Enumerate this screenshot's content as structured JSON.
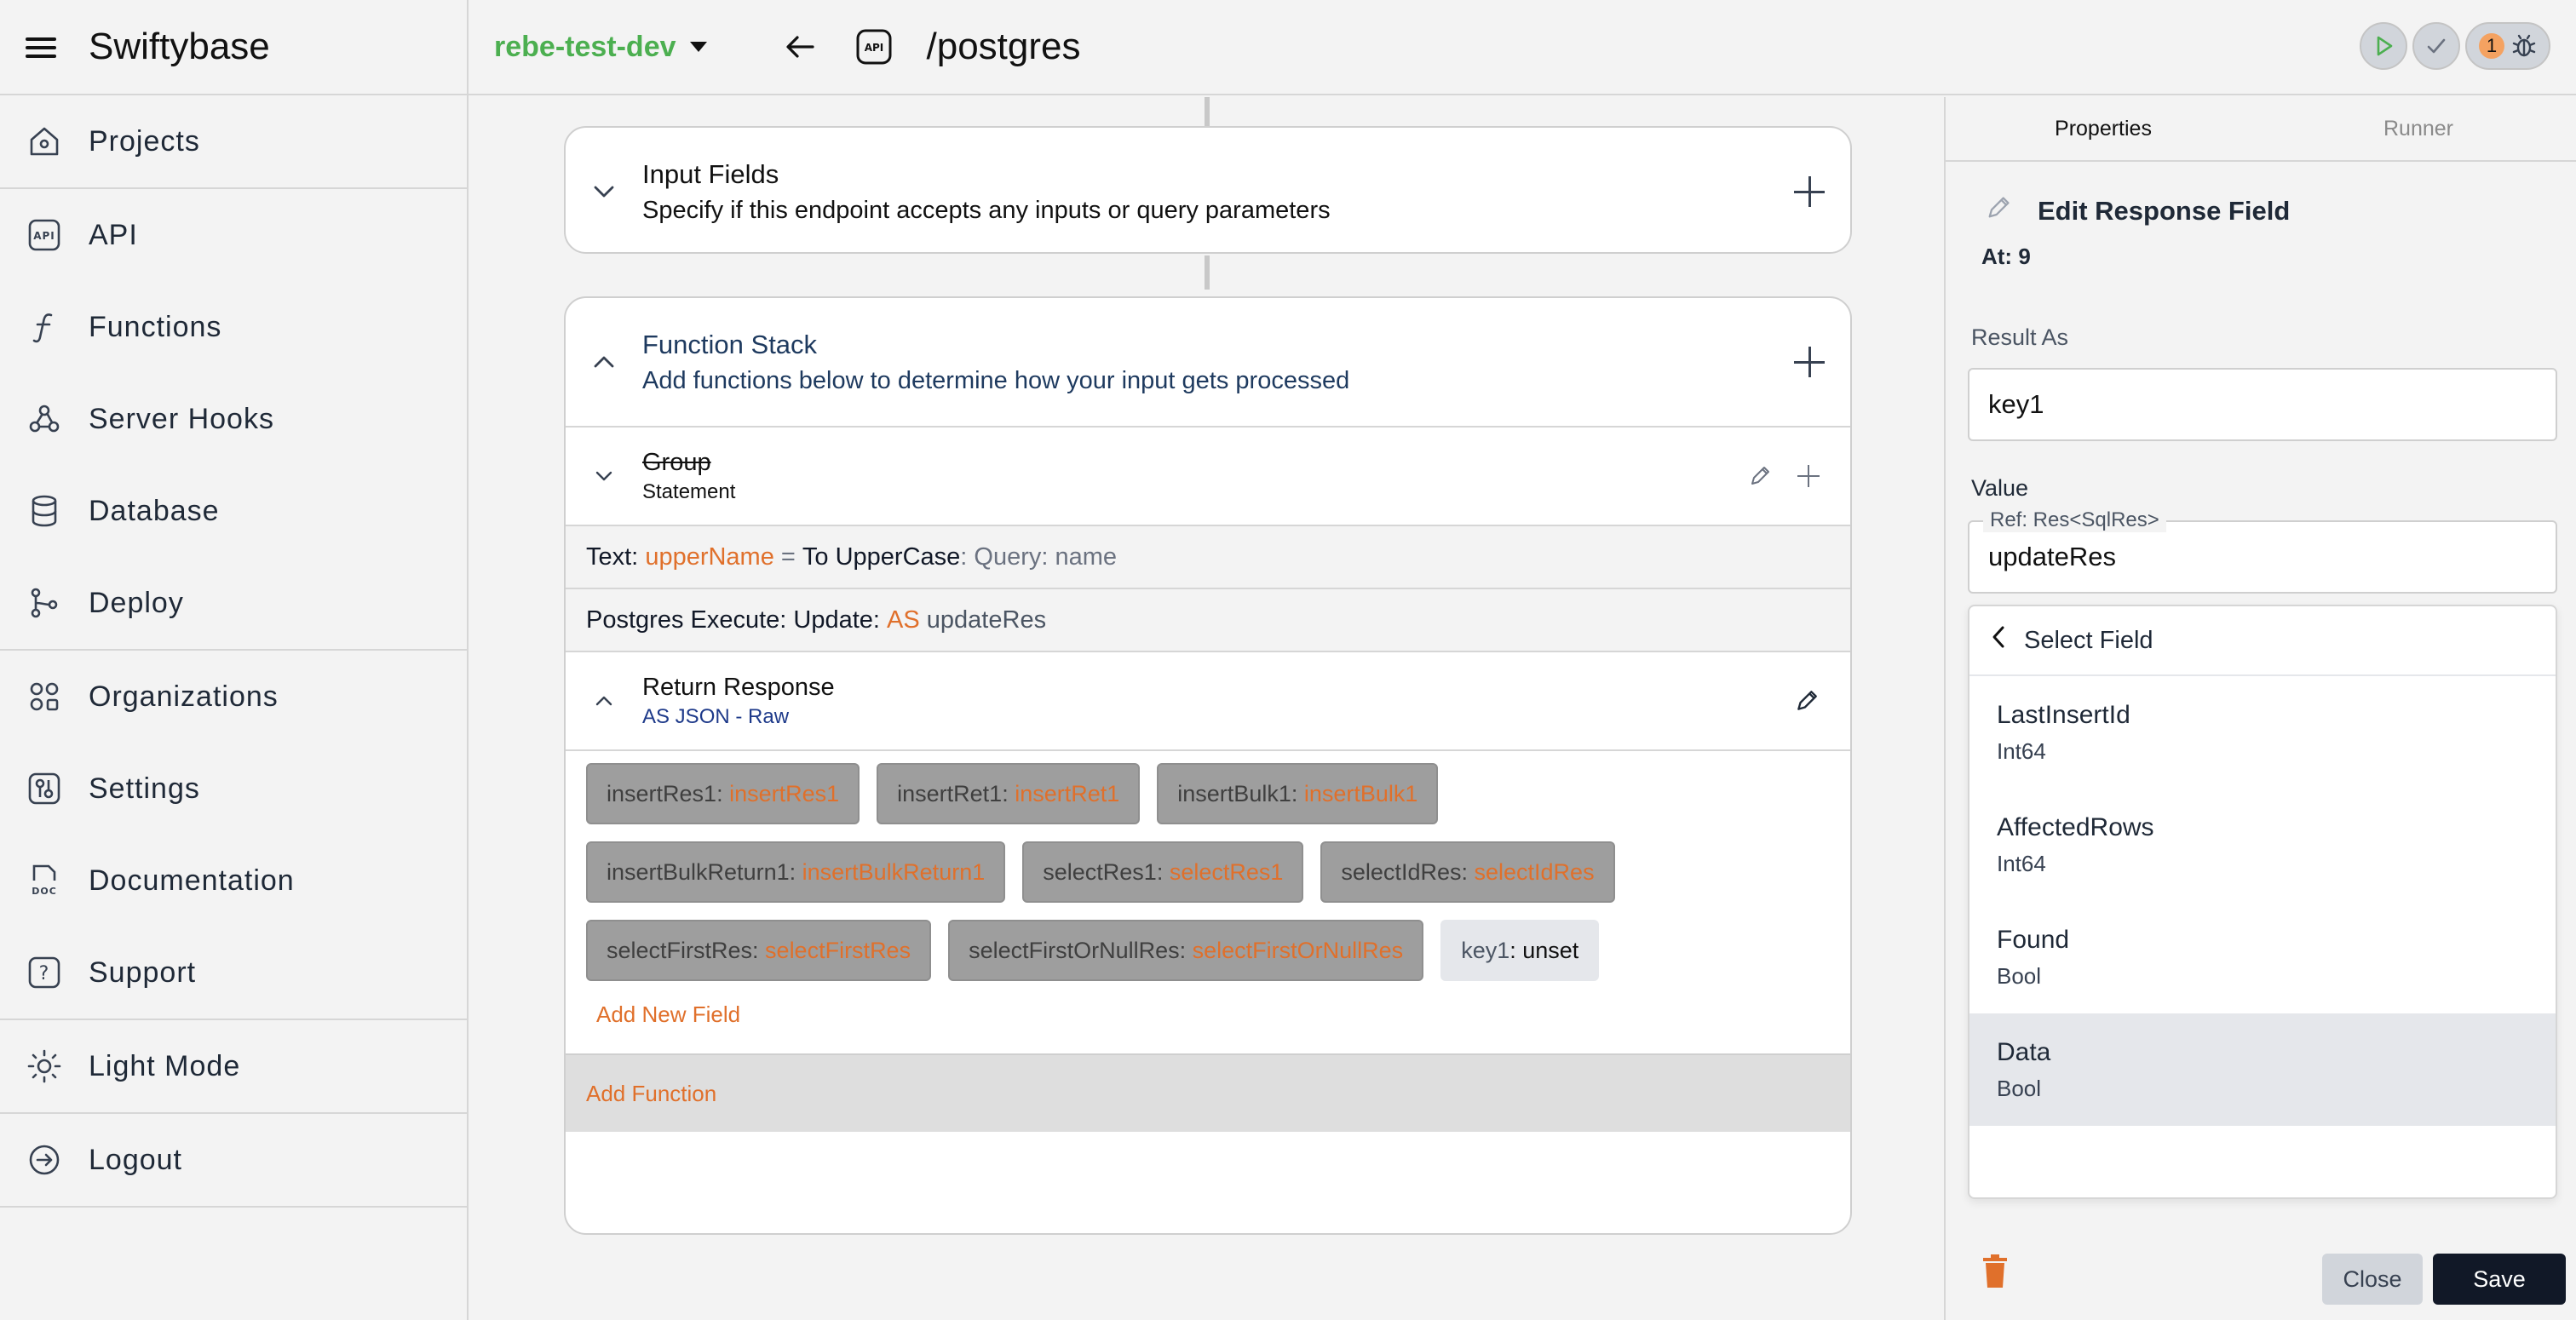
{
  "app": {
    "title": "Swiftybase"
  },
  "sidebar": {
    "items": [
      {
        "label": "Projects",
        "icon": "home-icon"
      },
      {
        "label": "API",
        "icon": "api-icon"
      },
      {
        "label": "Functions",
        "icon": "function-icon"
      },
      {
        "label": "Server Hooks",
        "icon": "webhook-icon"
      },
      {
        "label": "Database",
        "icon": "database-icon"
      },
      {
        "label": "Deploy",
        "icon": "git-branch-icon"
      },
      {
        "label": "Organizations",
        "icon": "organizations-icon"
      },
      {
        "label": "Settings",
        "icon": "settings-icon"
      },
      {
        "label": "Documentation",
        "icon": "doc-icon"
      },
      {
        "label": "Support",
        "icon": "help-icon"
      },
      {
        "label": "Light Mode",
        "icon": "sun-icon"
      },
      {
        "label": "Logout",
        "icon": "logout-icon"
      }
    ]
  },
  "topbar": {
    "project": "rebe-test-dev",
    "route": "/postgres",
    "api_badge": "API",
    "notification_count": "1"
  },
  "canvas": {
    "input_fields": {
      "title": "Input Fields",
      "subtitle": "Specify if this endpoint accepts any inputs or query parameters"
    },
    "function_stack": {
      "title": "Function Stack",
      "subtitle": "Add functions below to determine how your input gets processed",
      "group": {
        "title": "Group",
        "subtitle": "Statement"
      },
      "text_row": {
        "prefix": "Text:",
        "var": "upperName",
        "eq": "=",
        "fn": "To UpperCase",
        "colon": ":",
        "query": "Query: name"
      },
      "pg_row": {
        "prefix": "Postgres Execute: Update:",
        "as": "AS",
        "name": "updateRes"
      },
      "return": {
        "title": "Return Response",
        "subtitle": "AS JSON - Raw"
      },
      "chips": [
        {
          "key": "insertRes1",
          "value": "insertRes1"
        },
        {
          "key": "insertRet1",
          "value": "insertRet1"
        },
        {
          "key": "insertBulk1",
          "value": "insertBulk1"
        },
        {
          "key": "insertBulkReturn1",
          "value": "insertBulkReturn1"
        },
        {
          "key": "selectRes1",
          "value": "selectRes1"
        },
        {
          "key": "selectIdRes",
          "value": "selectIdRes"
        },
        {
          "key": "selectFirstRes",
          "value": "selectFirstRes"
        },
        {
          "key": "selectFirstOrNullRes",
          "value": "selectFirstOrNullRes"
        },
        {
          "key": "key1",
          "value": "unset"
        }
      ],
      "add_field": "Add New Field",
      "add_function": "Add Function"
    }
  },
  "panel": {
    "tabs": [
      "Properties",
      "Runner"
    ],
    "title": "Edit Response Field",
    "at": "At: 9",
    "result_as_label": "Result As",
    "result_as_value": "key1",
    "value_label": "Value",
    "value_legend": "Ref: Res<SqlRes>",
    "value_value": "updateRes",
    "dropdown": {
      "title": "Select Field",
      "items": [
        {
          "name": "LastInsertId",
          "type": "Int64"
        },
        {
          "name": "AffectedRows",
          "type": "Int64"
        },
        {
          "name": "Found",
          "type": "Bool"
        },
        {
          "name": "Data",
          "type": "Bool"
        }
      ]
    },
    "close_label": "Close",
    "save_label": "Save"
  }
}
